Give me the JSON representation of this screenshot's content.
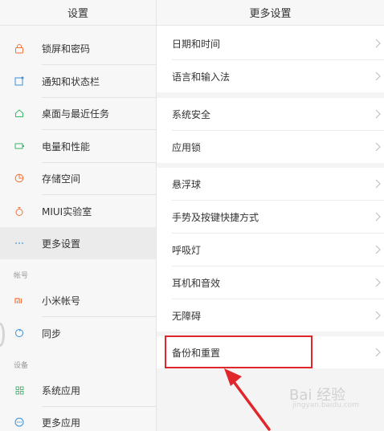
{
  "left_panel": {
    "title": "设置",
    "items": [
      {
        "label": "锁屏和密码",
        "icon": "lock-icon"
      },
      {
        "label": "通知和状态栏",
        "icon": "notification-icon"
      },
      {
        "label": "桌面与最近任务",
        "icon": "home-icon"
      },
      {
        "label": "电量和性能",
        "icon": "battery-icon"
      },
      {
        "label": "存储空间",
        "icon": "storage-icon"
      },
      {
        "label": "MIUI实验室",
        "icon": "lab-flask-icon"
      },
      {
        "label": "更多设置",
        "icon": "more-dots-icon"
      }
    ],
    "section_account": "帐号",
    "account_items": [
      {
        "label": "小米帐号",
        "icon": "mi-logo-icon"
      },
      {
        "label": "同步",
        "icon": "sync-icon"
      }
    ],
    "section_device": "设备",
    "device_items": [
      {
        "label": "系统应用",
        "icon": "grid-icon"
      },
      {
        "label": "更多应用",
        "icon": "more-apps-icon"
      }
    ]
  },
  "right_panel": {
    "title": "更多设置",
    "group1": [
      "日期和时间",
      "语言和输入法"
    ],
    "group2": [
      "系统安全",
      "应用锁"
    ],
    "group3": [
      "悬浮球",
      "手势及按键快捷方式",
      "呼吸灯",
      "耳机和音效",
      "无障碍"
    ],
    "group4": [
      "备份和重置"
    ]
  },
  "watermark": {
    "brand": "Bai 经验",
    "url": "jingyan.baidu.com"
  },
  "colors": {
    "accent_orange": "#f5733a",
    "highlight_red": "#e0262b"
  }
}
